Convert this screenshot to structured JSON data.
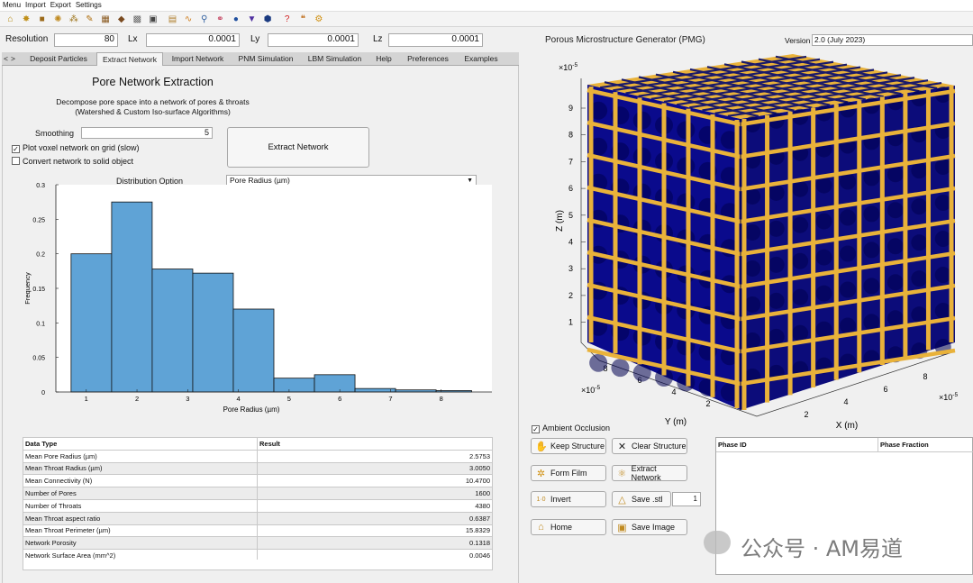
{
  "menu": [
    "Menu",
    "Import",
    "Export",
    "Settings"
  ],
  "toolbar_icons": [
    {
      "name": "home-icon",
      "glyph": "⌂",
      "color": "#b58a10"
    },
    {
      "name": "particles-icon",
      "glyph": "✸",
      "color": "#c0901a"
    },
    {
      "name": "cube-icon",
      "glyph": "■",
      "color": "#9c6a1a"
    },
    {
      "name": "gear-cluster-icon",
      "glyph": "✺",
      "color": "#c08a20"
    },
    {
      "name": "fibers-icon",
      "glyph": "⁂",
      "color": "#a07820"
    },
    {
      "name": "pen-icon",
      "glyph": "✎",
      "color": "#b07010"
    },
    {
      "name": "block-icon",
      "glyph": "▦",
      "color": "#8a5a20"
    },
    {
      "name": "diamond-icon",
      "glyph": "◆",
      "color": "#7a4a20"
    },
    {
      "name": "mesh-icon",
      "glyph": "▩",
      "color": "#666"
    },
    {
      "name": "cube-dark-icon",
      "glyph": "▣",
      "color": "#444"
    },
    {
      "name": "image-icon",
      "glyph": "▤",
      "color": "#b08030"
    },
    {
      "name": "curve-icon",
      "glyph": "∿",
      "color": "#d08020"
    },
    {
      "name": "network-icon",
      "glyph": "⚲",
      "color": "#3060a0"
    },
    {
      "name": "graph-icon",
      "glyph": "⚭",
      "color": "#c03050"
    },
    {
      "name": "drop-icon",
      "glyph": "●",
      "color": "#2050a0"
    },
    {
      "name": "funnel-icon",
      "glyph": "▼",
      "color": "#5030a0"
    },
    {
      "name": "box-icon",
      "glyph": "⬢",
      "color": "#1a3a80"
    },
    {
      "name": "help-icon",
      "glyph": "?",
      "color": "#d02020"
    },
    {
      "name": "quote-icon",
      "glyph": "❝",
      "color": "#c07020"
    },
    {
      "name": "settings-icon",
      "glyph": "⚙",
      "color": "#d09010"
    }
  ],
  "params": {
    "resolution_label": "Resolution",
    "resolution": "80",
    "lx_label": "Lx",
    "lx": "0.0001",
    "ly_label": "Ly",
    "ly": "0.0001",
    "lz_label": "Lz",
    "lz": "0.0001"
  },
  "tabs": [
    "<",
    ">",
    "Deposit Particles",
    "Extract Network",
    "Import Network",
    "PNM Simulation",
    "LBM Simulation",
    "Help",
    "Preferences",
    "Examples"
  ],
  "panel": {
    "title": "Pore Network Extraction",
    "desc1": "Decompose pore space into a network of pores & throats",
    "desc2": "(Watershed & Custom Iso-surface Algorithms)",
    "smoothing_label": "Smoothing",
    "smoothing": "5",
    "opt1": "Plot voxel network on grid (slow)",
    "opt2": "Convert network to solid object",
    "extract_btn": "Extract Network",
    "dist_label": "Distribution Option",
    "dist_value": "Pore Radius (µm)"
  },
  "chart_data": {
    "type": "bar",
    "xlabel": "Pore Radius (µm)",
    "ylabel": "Frequency",
    "ylim": [
      0,
      0.3
    ],
    "xlim": [
      0.4,
      9.0
    ],
    "xticks": [
      1,
      2,
      3,
      4,
      5,
      6,
      7,
      8
    ],
    "yticks": [
      0,
      0.05,
      0.1,
      0.15,
      0.2,
      0.25,
      0.3
    ],
    "bin_edges": [
      0.7,
      1.5,
      2.3,
      3.1,
      3.9,
      4.7,
      5.5,
      6.3,
      7.1,
      7.9,
      8.6
    ],
    "values": [
      0.2,
      0.275,
      0.178,
      0.172,
      0.12,
      0.02,
      0.025,
      0.005,
      0.003,
      0.002
    ],
    "color": "#5fa3d6"
  },
  "results": {
    "headers": [
      "Data Type",
      "Result"
    ],
    "rows": [
      [
        "Mean Pore Radius (µm)",
        "2.5753"
      ],
      [
        "Mean Throat Radius (µm)",
        "3.0050"
      ],
      [
        "Mean Connectivity (N)",
        "10.4700"
      ],
      [
        "Number of Pores",
        "1600"
      ],
      [
        "Number of Throats",
        "4380"
      ],
      [
        "Mean Throat aspect ratio",
        "0.6387"
      ],
      [
        "Mean Throat Perimeter (µm)",
        "15.8329"
      ],
      [
        "Network Porosity",
        "0.1318"
      ],
      [
        "Network Surface Area (mm^2)",
        "0.0046"
      ]
    ]
  },
  "viewer": {
    "app_title": "Porous Microstructure Generator (PMG)",
    "version_label": "Version",
    "version": "2.0 (July 2023)",
    "z_label": "Z (m)",
    "y_label": "Y (m)",
    "x_label": "X (m)",
    "exp_label": "×10",
    "exp_power": "-5",
    "z_ticks": [
      "9",
      "8",
      "7",
      "6",
      "5",
      "4",
      "3",
      "2",
      "1"
    ],
    "y_ticks": [
      "8",
      "6",
      "4",
      "2"
    ],
    "x_ticks": [
      "2",
      "4",
      "6",
      "8"
    ],
    "solid_color": "#e9b23a",
    "pore_color": "#0a0a8c"
  },
  "controls": {
    "ambient_occlusion": "Ambient Occlusion",
    "keep_structure": "Keep Structure",
    "clear_structure": "Clear Structure",
    "form_film": "Form Film",
    "extract_network": "Extract Network",
    "invert": "Invert",
    "save_stl": "Save .stl",
    "stl_count": "1",
    "home": "Home",
    "save_image": "Save Image",
    "phase_id": "Phase ID",
    "phase_fraction": "Phase Fraction"
  },
  "watermark": "公众号 · AM易道"
}
